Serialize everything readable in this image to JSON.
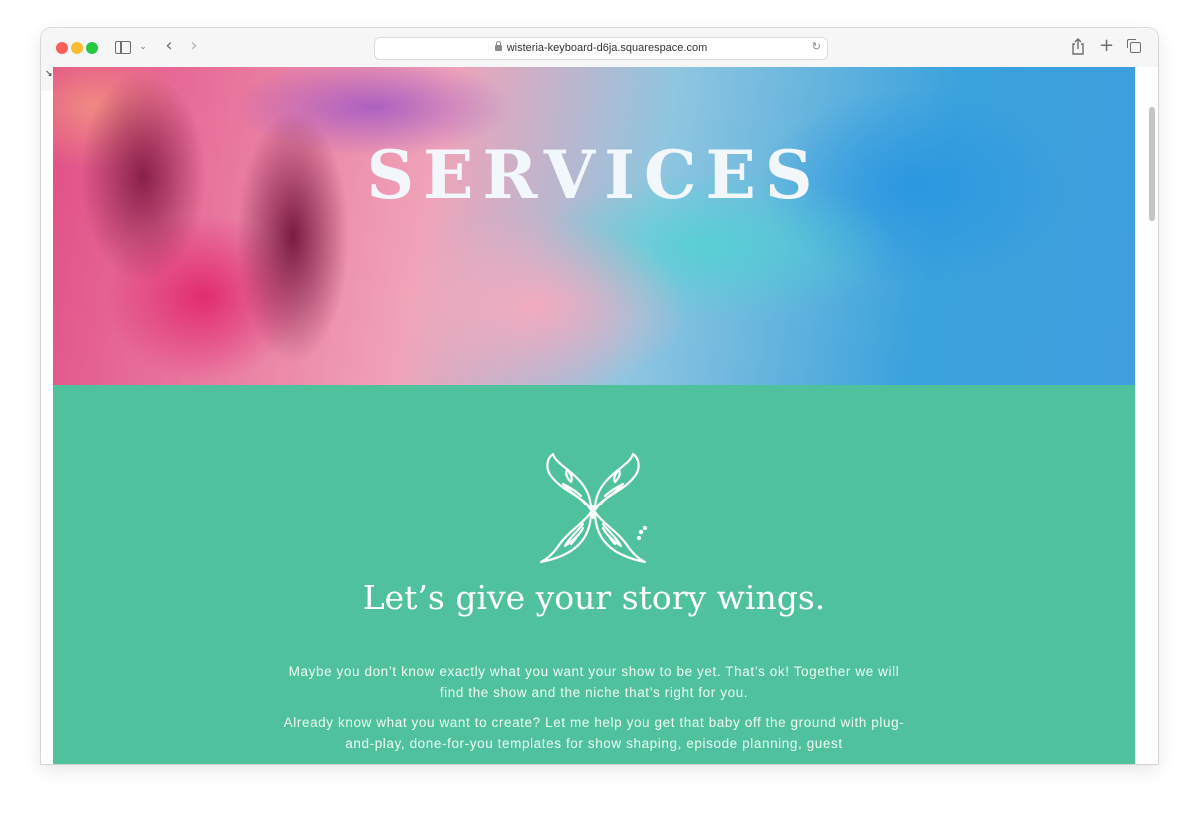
{
  "browser": {
    "url": "wisteria-keyboard-d6ja.squarespace.com",
    "icons": {
      "sidebar": "sidebar-icon",
      "chevron": "chevron-down-icon",
      "back": "back-arrow-icon",
      "forward": "forward-arrow-icon",
      "lock": "lock-icon",
      "reload": "reload-icon",
      "share": "share-icon",
      "new_tab": "plus-icon",
      "tabs": "tab-overview-icon"
    }
  },
  "hero": {
    "title": "SERVICES"
  },
  "section": {
    "background": "#4fc29d",
    "logo_icon": "butterfly-icon",
    "headline": "Let’s give your story wings.",
    "paragraph1": "Maybe you don’t know exactly what you want your show to be yet. That’s ok! Together we will find the show and the niche that’s right for you.",
    "paragraph2": "Already know what you want to create? Let me help you get that baby off the ground with plug-and-play, done-for-you templates for show shaping, episode planning, guest"
  }
}
